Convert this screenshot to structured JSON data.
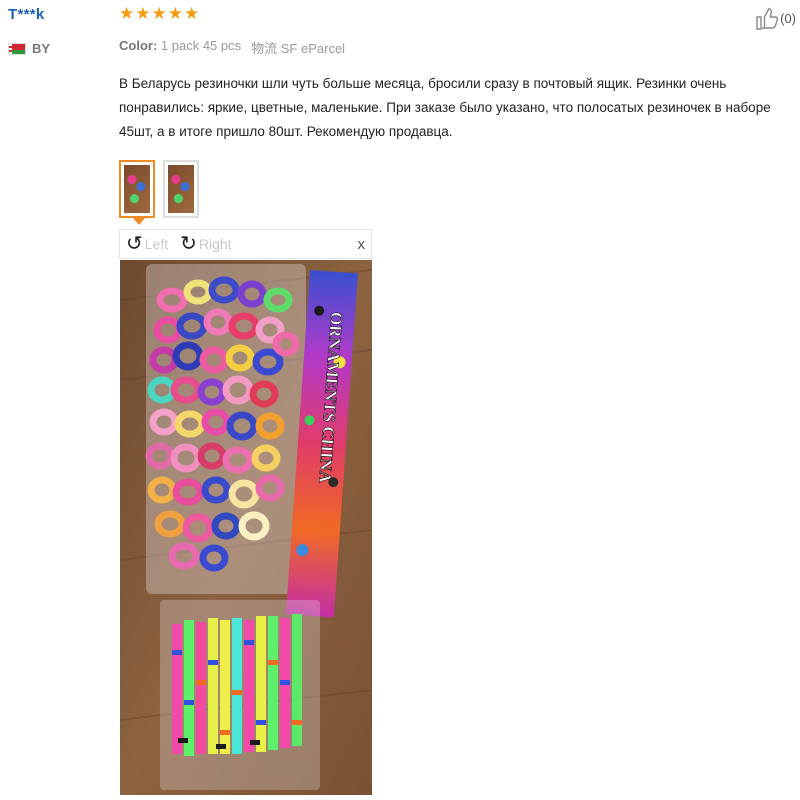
{
  "reviewer": {
    "name": "T***k",
    "country_code": "BY"
  },
  "rating": {
    "stars": 5,
    "max": 5,
    "color": "#f39c12"
  },
  "helpful": {
    "count": "(0)",
    "icon": "thumbs-up-icon"
  },
  "order_info": {
    "color_label": "Color:",
    "color_value": "1 pack 45 pcs",
    "shipping_label": "物流",
    "shipping_value": "SF eParcel"
  },
  "review": {
    "text": "В Беларусь резиночки шли чуть больше месяца, бросили сразу в почтовый ящик. Резинки очень понравились: яркие, цветные, маленькие. При заказе было указано, что полосатых резиночек в наборе 45шт, а в итоге пришло 80шт. Рекомендую продавца."
  },
  "viewer": {
    "rotate_left_label": "Left",
    "rotate_right_label": "Right",
    "close_label": "x",
    "card_text": "ORNAMENTS CHINA"
  },
  "colors": {
    "username": "#1a5fb4",
    "active_thumb_border": "#f08a24"
  }
}
